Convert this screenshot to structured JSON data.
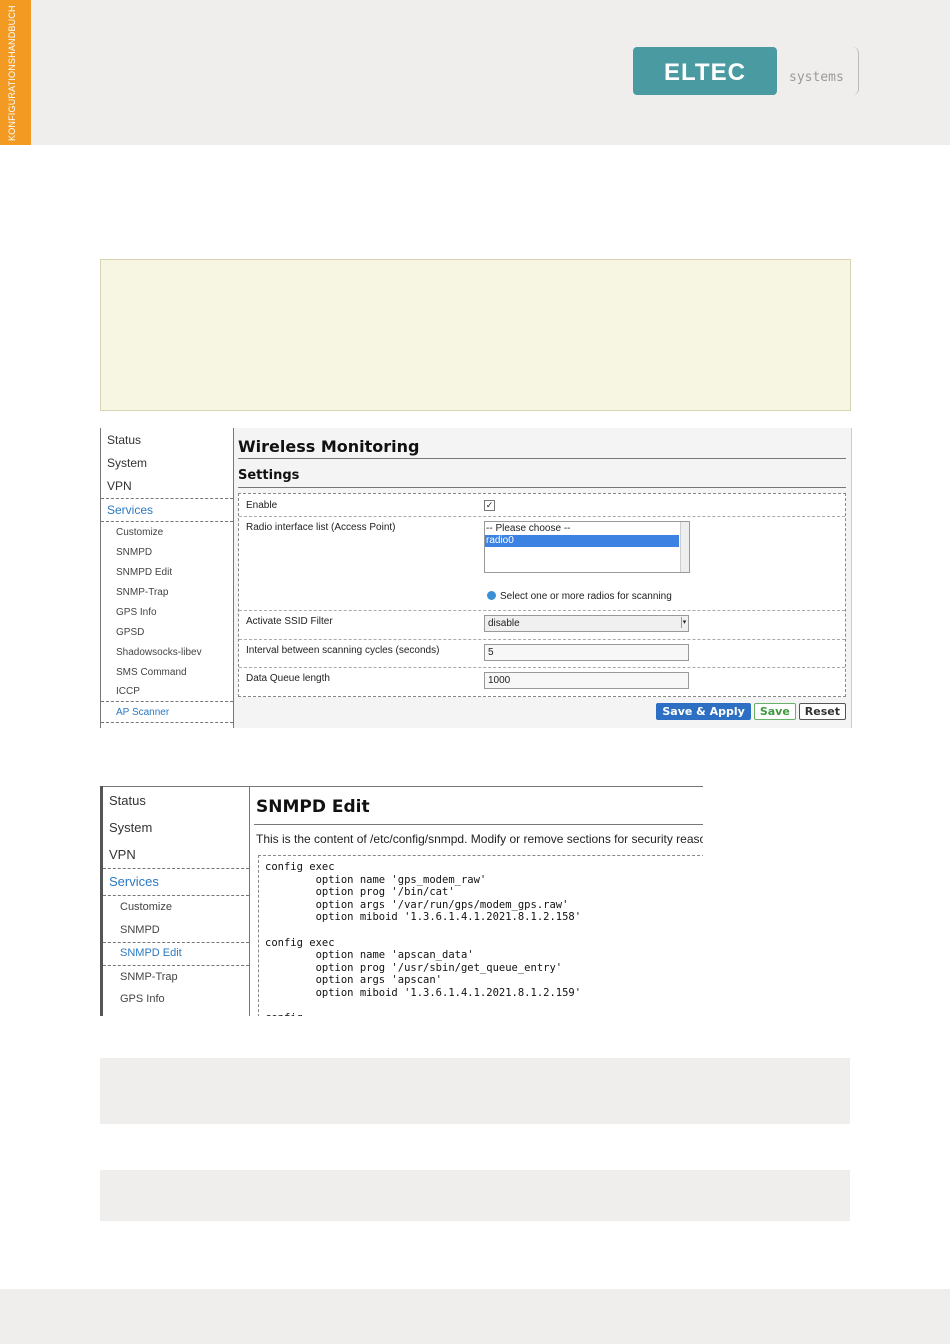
{
  "header": {
    "side_tab": "KONFIGURATIONSHANDBUCH",
    "logo_text": "ELTEC",
    "logo_sub": "systems"
  },
  "screenshot1": {
    "nav": {
      "top": [
        "Status",
        "System",
        "VPN",
        "Services"
      ],
      "sub": [
        "Customize",
        "SNMPD",
        "SNMPD Edit",
        "SNMP-Trap",
        "GPS Info",
        "GPSD",
        "Shadowsocks-libev",
        "SMS Command",
        "ICCP",
        "AP Scanner"
      ]
    },
    "title": "Wireless Monitoring",
    "section": "Settings",
    "fields": {
      "enable_label": "Enable",
      "radio_label": "Radio interface list (Access Point)",
      "radio_options": [
        "-- Please choose --",
        "radio0"
      ],
      "radio_hint": "Select one or more radios for scanning",
      "ssid_label": "Activate SSID Filter",
      "ssid_value": "disable",
      "interval_label": "Interval between scanning cycles (seconds)",
      "interval_value": "5",
      "queue_label": "Data Queue length",
      "queue_value": "1000"
    },
    "buttons": {
      "apply": "Save & Apply",
      "save": "Save",
      "reset": "Reset"
    }
  },
  "screenshot2": {
    "nav": {
      "top": [
        "Status",
        "System",
        "VPN",
        "Services"
      ],
      "sub": [
        "Customize",
        "SNMPD",
        "SNMPD Edit",
        "SNMP-Trap",
        "GPS Info"
      ]
    },
    "title": "SNMPD Edit",
    "description": "This is the content of /etc/config/snmpd. Modify or remove sections for security reasons.",
    "code": "config exec\n        option name 'gps_modem_raw'\n        option prog '/bin/cat'\n        option args '/var/run/gps/modem_gps.raw'\n        option miboid '1.3.6.1.4.1.2021.8.1.2.158'\n\nconfig exec\n        option name 'apscan_data'\n        option prog '/usr/sbin/get_queue_entry'\n        option args 'apscan'\n        option miboid '1.3.6.1.4.1.2021.8.1.2.159'\n\nconfig"
  }
}
